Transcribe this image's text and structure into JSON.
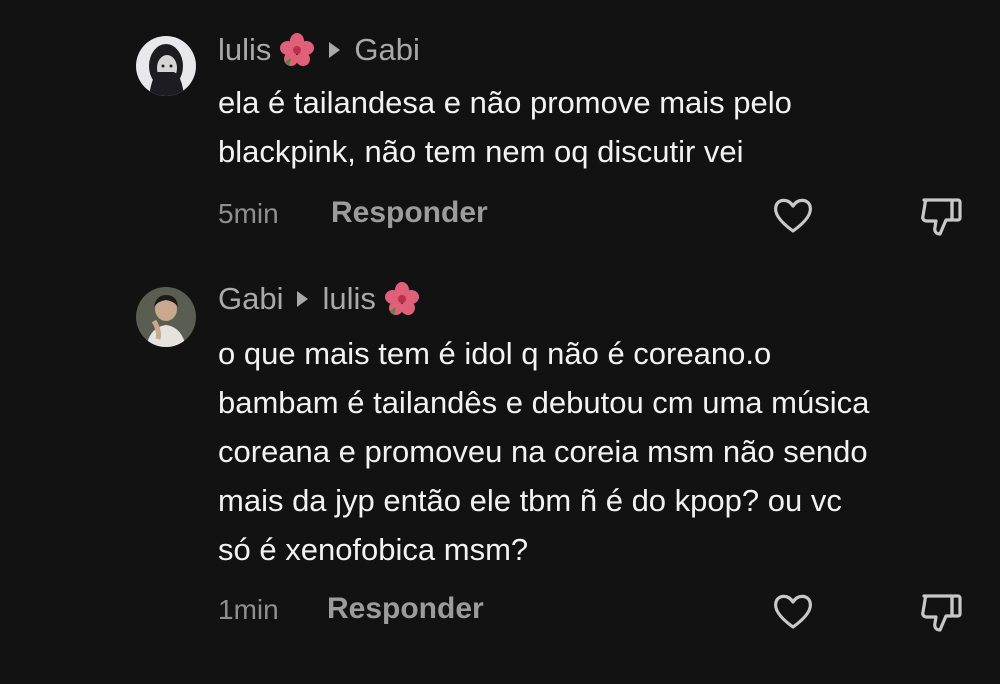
{
  "comments": [
    {
      "author": "lulis",
      "reply_to": "Gabi",
      "flower_on": "author",
      "lines": [
        "ela é tailandesa e não promove mais pelo",
        "blackpink, não tem nem oq discutir vei"
      ],
      "time": "5min",
      "reply_label": "Responder"
    },
    {
      "author": "Gabi",
      "reply_to": "lulis",
      "flower_on": "reply_to",
      "lines": [
        "o que mais tem é idol q não é coreano.o",
        "bambam é tailandês e debutou cm uma música",
        "coreana e promoveu na coreia msm não sendo",
        "mais da jyp então ele tbm ñ é do kpop? ou vc",
        "só é xenofobica msm?"
      ],
      "time": "1min",
      "reply_label": "Responder"
    }
  ],
  "next_comment_partial": "",
  "icons": {
    "like": "heart-icon",
    "dislike": "thumbs-down-icon",
    "reply_arrow": "play-arrow-icon",
    "emoji": "hibiscus-icon"
  },
  "colors": {
    "background": "#121212",
    "author_text": "#a9a9a9",
    "body_text": "#f2f2f2",
    "meta_text": "#8f8f8f",
    "flower_pink": "#e0607a"
  }
}
